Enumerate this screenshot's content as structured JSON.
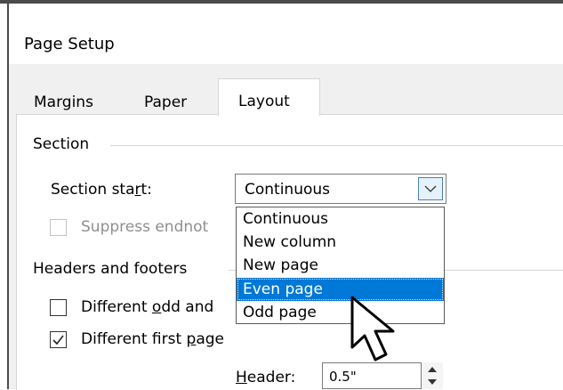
{
  "dialog": {
    "title": "Page Setup"
  },
  "tabs": [
    {
      "label": "Margins"
    },
    {
      "label": "Paper"
    },
    {
      "label": "Layout"
    }
  ],
  "section": {
    "group_label": "Section",
    "section_start_label_pre": "Section sta",
    "section_start_label_u": "r",
    "section_start_label_post": "t:",
    "section_start_value": "Continuous",
    "suppress_label": "Suppress endnot",
    "dropdown_options": [
      "Continuous",
      "New column",
      "New page",
      "Even page",
      "Odd page"
    ],
    "selected_option": "Even page"
  },
  "headers_footers": {
    "group_label": "Headers and footers",
    "odd_even_pre": "Different ",
    "odd_even_u": "o",
    "odd_even_post": "dd and",
    "odd_even_checked": false,
    "first_page_pre": "Different first ",
    "first_page_u": "p",
    "first_page_post": "age",
    "first_page_checked": true,
    "header_label_u": "H",
    "header_label_post": "eader:",
    "header_value": "0.5\""
  },
  "colors": {
    "selection": "#0078d7",
    "accent_border": "#4a7fc0"
  }
}
